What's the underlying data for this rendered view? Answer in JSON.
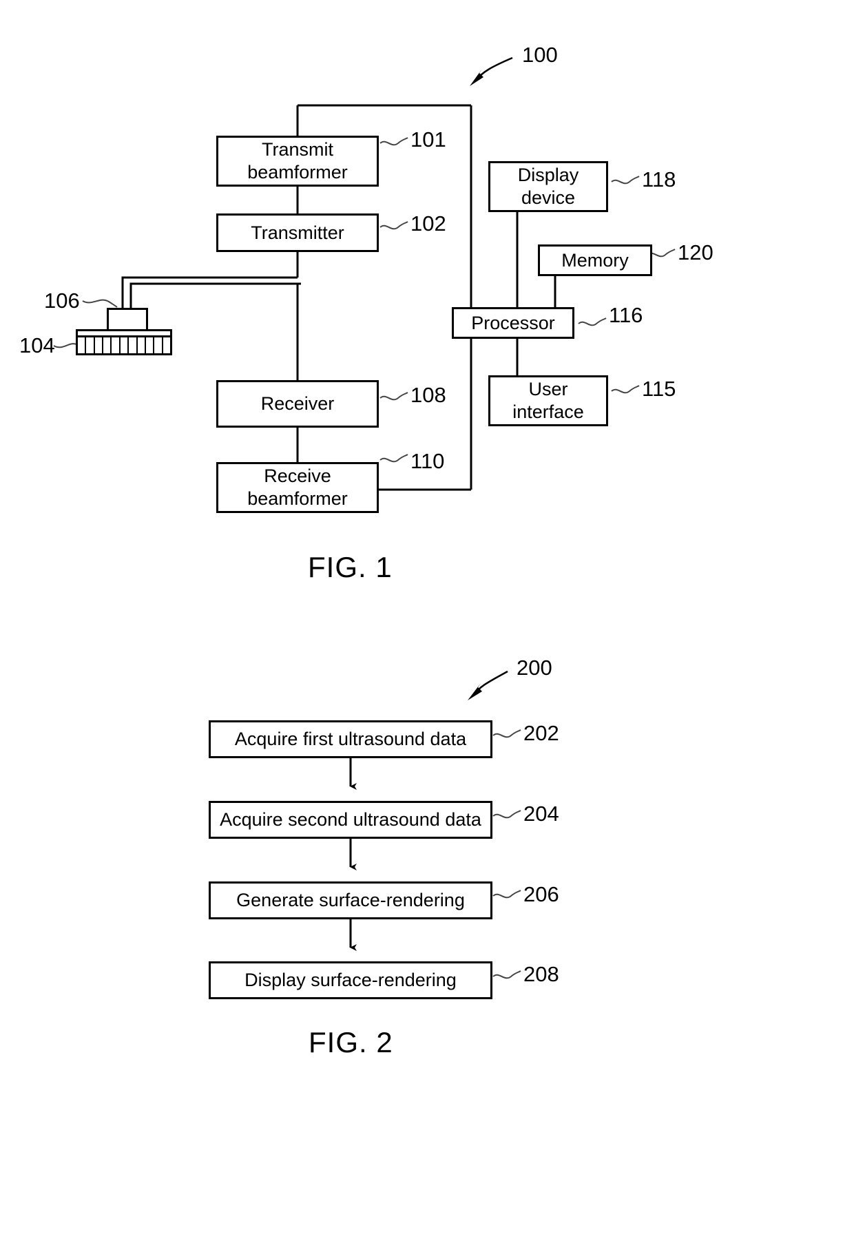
{
  "figures": [
    {
      "id": "fig1",
      "caption": "FIG. 1",
      "system_ref": "100",
      "blocks": {
        "transmit_beamformer": {
          "label": "Transmit\nbeamformer",
          "ref": "101"
        },
        "transmitter": {
          "label": "Transmitter",
          "ref": "102"
        },
        "probe_housing": {
          "label": "",
          "ref": "106"
        },
        "transducer_array": {
          "label": "",
          "ref": "104",
          "element_count": 11
        },
        "receiver": {
          "label": "Receiver",
          "ref": "108"
        },
        "receive_beamformer": {
          "label": "Receive\nbeamformer",
          "ref": "110"
        },
        "display_device": {
          "label": "Display\ndevice",
          "ref": "118"
        },
        "memory": {
          "label": "Memory",
          "ref": "120"
        },
        "processor": {
          "label": "Processor",
          "ref": "116"
        },
        "user_interface": {
          "label": "User\ninterface",
          "ref": "115"
        }
      }
    },
    {
      "id": "fig2",
      "caption": "FIG. 2",
      "method_ref": "200",
      "steps": [
        {
          "label": "Acquire first ultrasound data",
          "ref": "202"
        },
        {
          "label": "Acquire second ultrasound data",
          "ref": "204"
        },
        {
          "label": "Generate surface-rendering",
          "ref": "206"
        },
        {
          "label": "Display surface-rendering",
          "ref": "208"
        }
      ]
    }
  ],
  "fig1": {
    "caption": "FIG. 1",
    "ref_100": "100",
    "transmit_beamformer_line1": "Transmit",
    "transmit_beamformer_line2": "beamformer",
    "ref_101": "101",
    "transmitter": "Transmitter",
    "ref_102": "102",
    "ref_106": "106",
    "ref_104": "104",
    "receiver": "Receiver",
    "ref_108": "108",
    "receive_beamformer_line1": "Receive",
    "receive_beamformer_line2": "beamformer",
    "ref_110": "110",
    "display_device_line1": "Display",
    "display_device_line2": "device",
    "ref_118": "118",
    "memory": "Memory",
    "ref_120": "120",
    "processor": "Processor",
    "ref_116": "116",
    "user_interface_line1": "User",
    "user_interface_line2": "interface",
    "ref_115": "115"
  },
  "fig2": {
    "caption": "FIG. 2",
    "ref_200": "200",
    "step_1": "Acquire first ultrasound data",
    "ref_202": "202",
    "step_2": "Acquire second ultrasound data",
    "ref_204": "204",
    "step_3": "Generate surface-rendering",
    "ref_206": "206",
    "step_4": "Display surface-rendering",
    "ref_208": "208"
  },
  "colors": {
    "ink": "#000000",
    "paper": "#ffffff"
  }
}
